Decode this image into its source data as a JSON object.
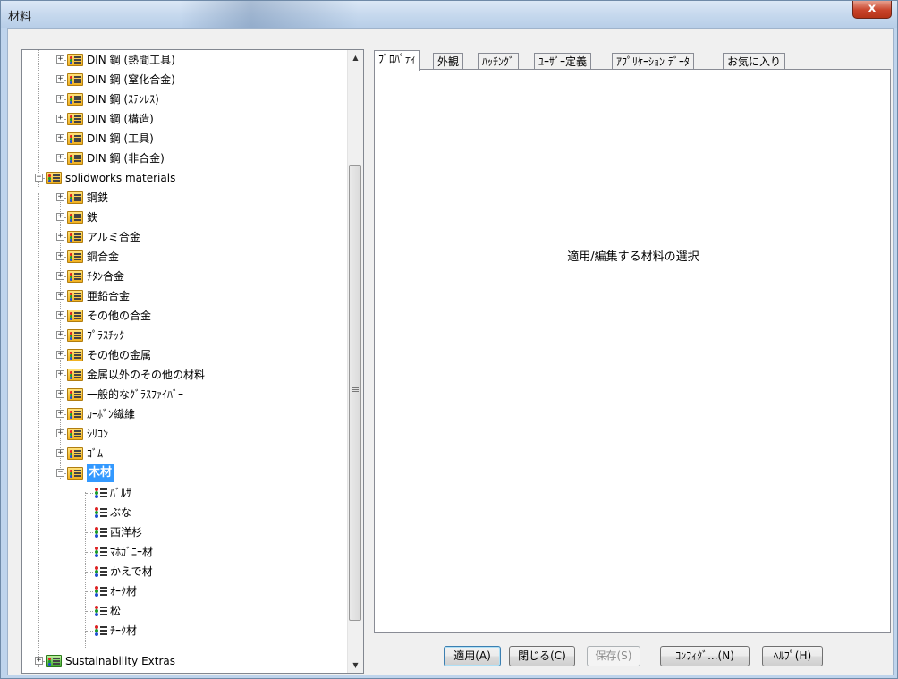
{
  "window": {
    "title": "材料",
    "close_label": "x"
  },
  "tree": {
    "nodes": [
      {
        "label": "DIN 鋼 (熱間工具)"
      },
      {
        "label": "DIN 鋼 (窒化合金)"
      },
      {
        "label": "DIN 鋼 (ｽﾃﾝﾚｽ)"
      },
      {
        "label": "DIN 鋼 (構造)"
      },
      {
        "label": "DIN 鋼 (工具)"
      },
      {
        "label": "DIN 鋼 (非合金)"
      },
      {
        "label": "solidworks materials"
      },
      {
        "label": "鋼鉄"
      },
      {
        "label": "鉄"
      },
      {
        "label": "アルミ合金"
      },
      {
        "label": "銅合金"
      },
      {
        "label": "ﾁﾀﾝ合金"
      },
      {
        "label": "亜鉛合金"
      },
      {
        "label": "その他の合金"
      },
      {
        "label": "ﾌﾟﾗｽﾁｯｸ"
      },
      {
        "label": "その他の金属"
      },
      {
        "label": "金属以外のその他の材料"
      },
      {
        "label": "一般的なｸﾞﾗｽﾌｧｲﾊﾞｰ"
      },
      {
        "label": "ｶｰﾎﾞﾝ繊維"
      },
      {
        "label": "ｼﾘｺﾝ"
      },
      {
        "label": "ｺﾞﾑ"
      },
      {
        "label": "木材"
      },
      {
        "label": "ﾊﾞﾙｻ"
      },
      {
        "label": "ぶな"
      },
      {
        "label": "西洋杉"
      },
      {
        "label": "ﾏﾎｶﾞﾆｰ材"
      },
      {
        "label": "かえで材"
      },
      {
        "label": "ｵｰｸ材"
      },
      {
        "label": "松"
      },
      {
        "label": "ﾁｰｸ材"
      },
      {
        "label": "Sustainability Extras"
      }
    ]
  },
  "tabs": [
    {
      "label": "ﾌﾟﾛﾊﾟﾃｨ"
    },
    {
      "label": "外観"
    },
    {
      "label": "ﾊｯﾁﾝｸﾞ"
    },
    {
      "label": "ﾕｰｻﾞｰ定義"
    },
    {
      "label": "ｱﾌﾟﾘｹｰｼｮﾝ ﾃﾞｰﾀ"
    },
    {
      "label": "お気に入り"
    }
  ],
  "panel": {
    "message": "適用/編集する材料の選択"
  },
  "buttons": {
    "apply": "適用(A)",
    "close": "閉じる(C)",
    "save": "保存(S)",
    "config": "ｺﾝﾌｨｸﾞ...(N)",
    "help": "ﾍﾙﾌﾟ(H)"
  }
}
